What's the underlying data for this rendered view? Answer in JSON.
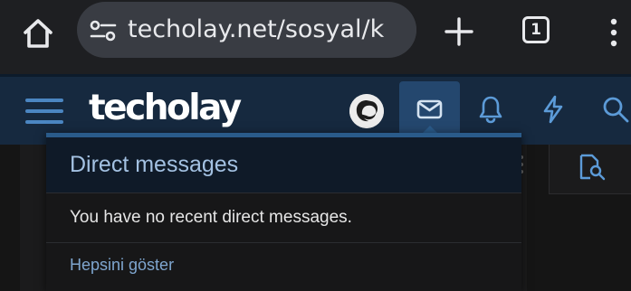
{
  "browser": {
    "url": "techolay.net/sosyal/k",
    "tab_count": "1"
  },
  "site": {
    "logo_text": "techolay"
  },
  "icons": {
    "home": "home-icon",
    "site_settings": "tune-icon",
    "new_tab": "plus-icon",
    "browser_menu": "more-vertical-icon",
    "hamburger": "menu-icon",
    "inbox": "envelope-icon",
    "alerts": "bell-icon",
    "whats_new": "bolt-icon",
    "search": "search-icon",
    "file_search": "file-search-icon"
  },
  "dropdown": {
    "title": "Direct messages",
    "empty_message": "You have no recent direct messages.",
    "footer_link": "Hepsini göster"
  },
  "colors": {
    "header_bg": "#16293f",
    "active_tab": "#24476e",
    "accent": "#2a5b8a",
    "link": "#7fa6cf"
  }
}
